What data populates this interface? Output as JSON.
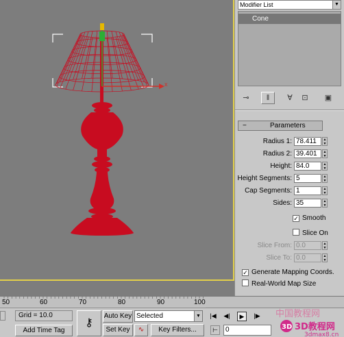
{
  "panel": {
    "modifier_list_label": "Modifier List",
    "stack_item": "Cone",
    "params_title": "Parameters",
    "params_collapse": "−",
    "fields": [
      {
        "label": "Radius 1:",
        "value": "78.411"
      },
      {
        "label": "Radius 2:",
        "value": "39.401"
      },
      {
        "label": "Height:",
        "value": "84.0"
      },
      {
        "label": "Height Segments:",
        "value": "5"
      },
      {
        "label": "Cap Segments:",
        "value": "1"
      },
      {
        "label": "Sides:",
        "value": "35"
      }
    ],
    "smooth_label": "Smooth",
    "slice_on_label": "Slice On",
    "slice_from_label": "Slice From:",
    "slice_from_value": "0.0",
    "slice_to_label": "Slice To:",
    "slice_to_value": "0.0",
    "gen_mapping_label": "Generate Mapping Coords.",
    "real_world_label": "Real-World Map Size",
    "checked_mark": "✓"
  },
  "viewport": {
    "axis_x_label": "x",
    "border_color": "#e3d04a",
    "lamp_color": "#c80c20"
  },
  "timeline": {
    "ticks": [
      "50",
      "60",
      "70",
      "80",
      "90",
      "100"
    ]
  },
  "bottom": {
    "grid_label": "Grid = 10.0",
    "add_time_tag": "Add Time Tag",
    "auto_key": "Auto Key",
    "set_key": "Set Key",
    "selected": "Selected",
    "key_filters": "Key Filters...",
    "frame_value": "0"
  },
  "watermark": {
    "text_cn": "中国教程网",
    "brand": "3D教程网",
    "url": "3dmax8.cn"
  }
}
